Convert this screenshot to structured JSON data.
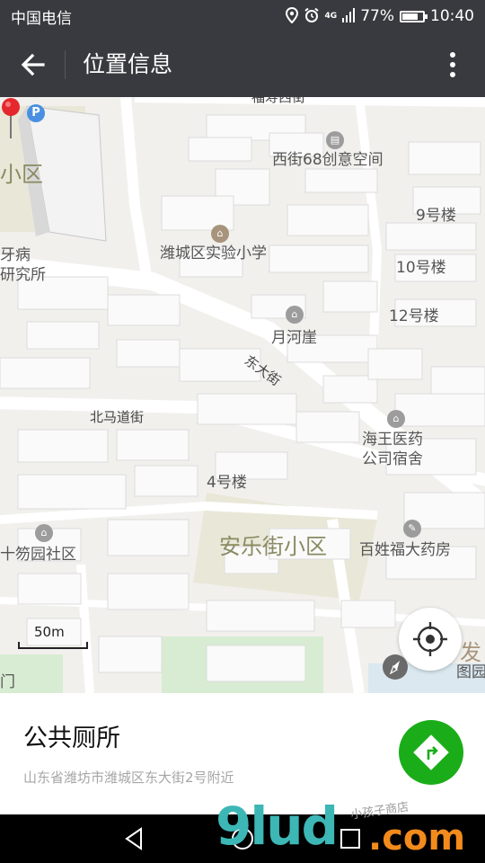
{
  "status_bar": {
    "carrier": "中国电信",
    "network": "4G",
    "battery_percent": "77%",
    "battery_level": 0.77,
    "time": "10:40"
  },
  "app_bar": {
    "title": "位置信息"
  },
  "map": {
    "labels": {
      "fuxing_west": "福寿西街",
      "xijie68": "西街68创意空间",
      "xiaoqu_left": "小区",
      "building9": "9号楼",
      "shiyan_school": "潍城区实验小学",
      "dental": "牙病",
      "institute": "研究所",
      "building10": "10号楼",
      "building12": "12号楼",
      "yuehe": "月河崖",
      "dongdajie": "东大街",
      "beimadao": "北马道街",
      "haiwang": "海王医药",
      "haiwang2": "公司宿舍",
      "building4": "4号楼",
      "anle": "安乐街小区",
      "baixing": "百姓福大药房",
      "shiyuyuan": "十笏园社区",
      "fa": "发",
      "bottom_left": "门",
      "bottom_right": "图园"
    },
    "scale": "50m"
  },
  "place": {
    "name": "公共厕所",
    "address": "山东省潍坊市潍城区东大街2号附近"
  },
  "watermark": {
    "brand": "9lud",
    "domain": ".com",
    "small_text": "小孩子商店"
  },
  "colors": {
    "bar": "#393a3f",
    "route": "#1aad19",
    "pin": "#e4282d"
  }
}
